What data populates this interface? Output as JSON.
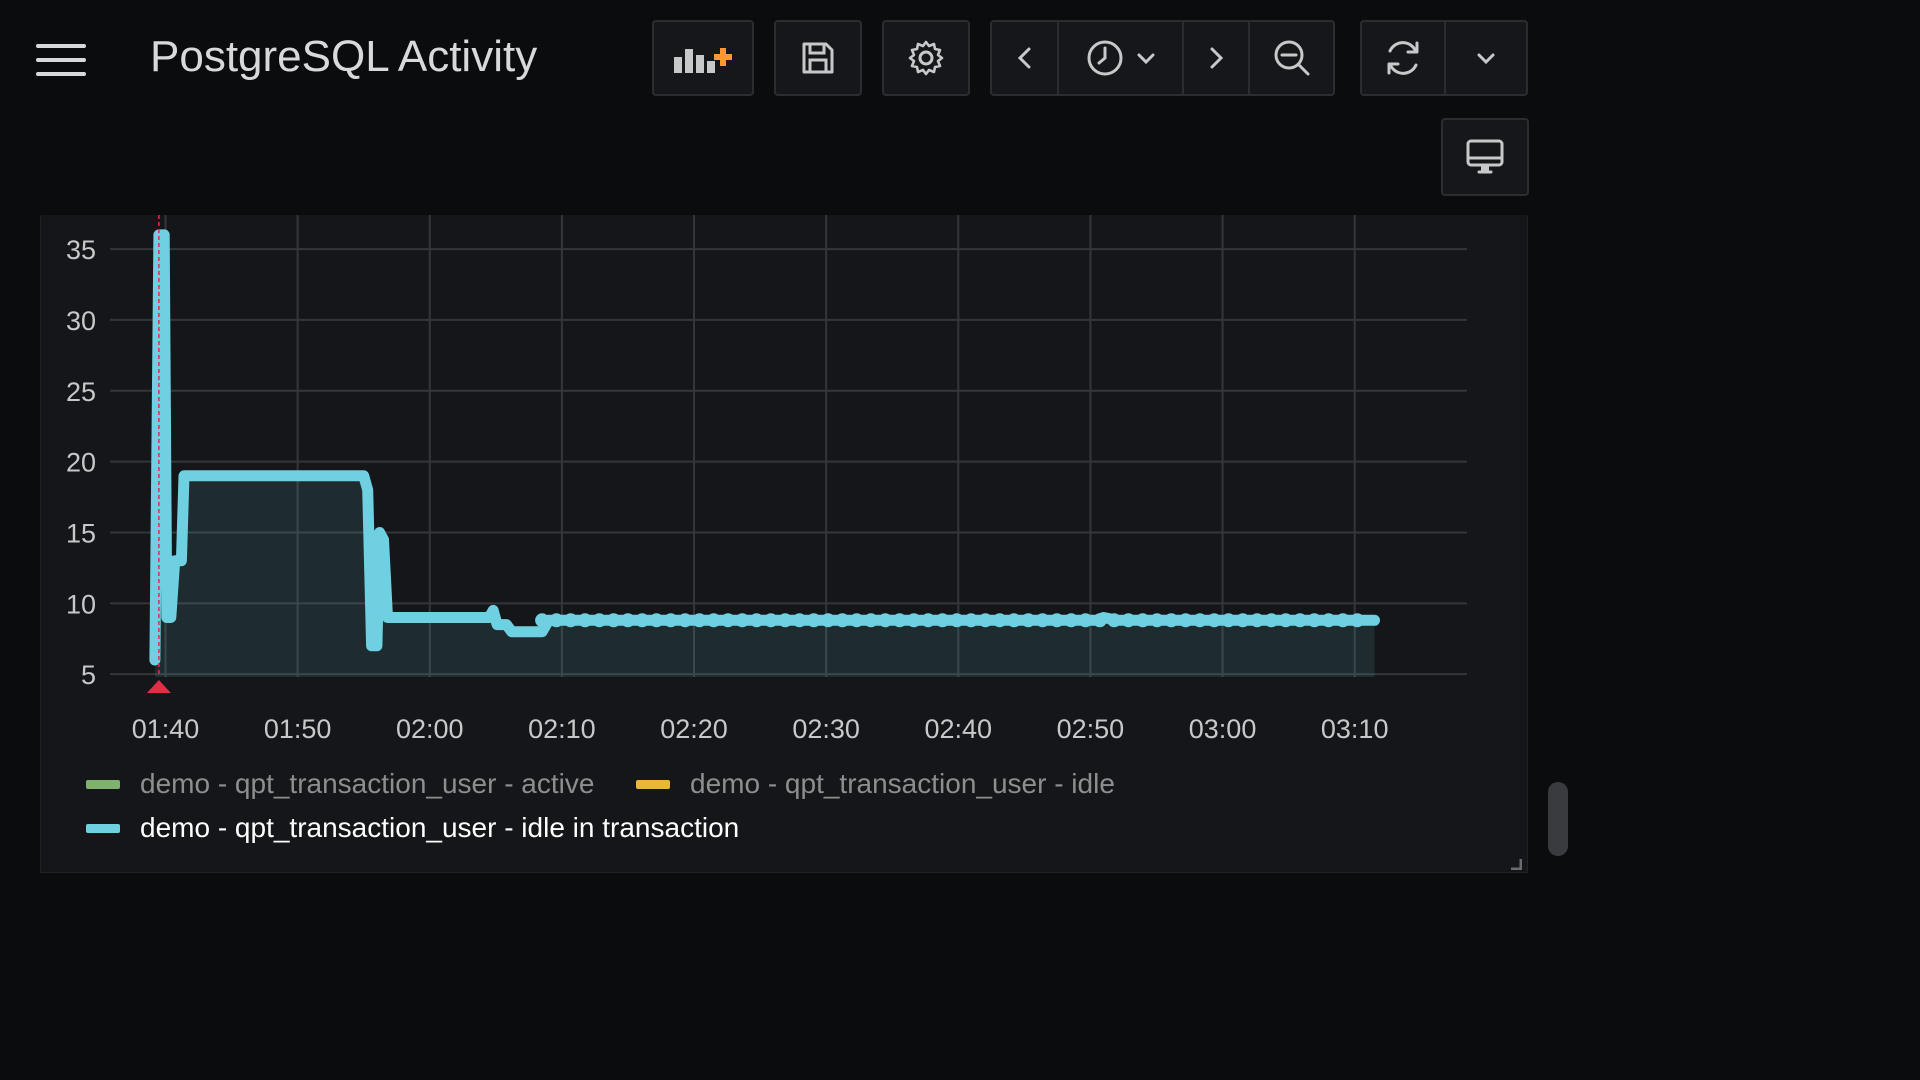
{
  "header": {
    "title": "PostgreSQL Activity",
    "accent_color": "#ff9830"
  },
  "toolbar": {
    "icons": [
      "add-panel-icon",
      "save-icon",
      "gear-icon",
      "chevron-left-icon",
      "clock-icon",
      "chevron-down-icon",
      "chevron-right-icon",
      "zoom-out-icon",
      "refresh-icon",
      "chevron-down-icon",
      "monitor-icon"
    ]
  },
  "chart_data": {
    "type": "area",
    "y_ticks": [
      "35",
      "30",
      "25",
      "20",
      "15",
      "10",
      "5"
    ],
    "x_ticks": [
      "01:40",
      "01:50",
      "02:00",
      "02:10",
      "02:20",
      "02:30",
      "02:40",
      "02:50",
      "03:00",
      "03:10"
    ],
    "ylim": [
      5,
      36
    ],
    "grid": true,
    "legend_placement": "bottom",
    "annotation_time": "01:39.5",
    "annotation_color": "#e02f44",
    "series": [
      {
        "name": "demo - qpt_transaction_user - active",
        "color": "#7eb26d",
        "values": []
      },
      {
        "name": "demo - qpt_transaction_user - idle",
        "color": "#eab839",
        "values": []
      },
      {
        "name": "demo - qpt_transaction_user - idle in transaction",
        "color": "#6ed0e0",
        "points": [
          [
            "01:39.2",
            6
          ],
          [
            "01:39.5",
            36
          ],
          [
            "01:39.9",
            36
          ],
          [
            "01:40.1",
            9
          ],
          [
            "01:40.4",
            9
          ],
          [
            "01:40.7",
            13
          ],
          [
            "01:41.2",
            13
          ],
          [
            "01:41.4",
            19
          ],
          [
            "01:55.0",
            19
          ],
          [
            "01:55.3",
            18
          ],
          [
            "01:55.6",
            7
          ],
          [
            "01:56.0",
            7
          ],
          [
            "01:56.2",
            15
          ],
          [
            "01:56.5",
            14.5
          ],
          [
            "01:56.8",
            9
          ],
          [
            "02:04.5",
            9
          ],
          [
            "02:04.8",
            9.5
          ],
          [
            "02:05.1",
            8.5
          ],
          [
            "02:05.8",
            8.5
          ],
          [
            "02:06.2",
            8
          ],
          [
            "02:08.5",
            8
          ],
          [
            "02:09.0",
            8.8
          ],
          [
            "02:50.5",
            8.8
          ],
          [
            "02:51.0",
            9
          ],
          [
            "02:52.0",
            8.8
          ],
          [
            "03:11.5",
            8.8
          ]
        ]
      }
    ]
  },
  "legend": {
    "items": [
      {
        "label": "demo - qpt_transaction_user - active",
        "color": "#7eb26d"
      },
      {
        "label": "demo - qpt_transaction_user - idle",
        "color": "#eab839"
      },
      {
        "label": "demo - qpt_transaction_user - idle in transaction",
        "color": "#6ed0e0"
      }
    ]
  }
}
